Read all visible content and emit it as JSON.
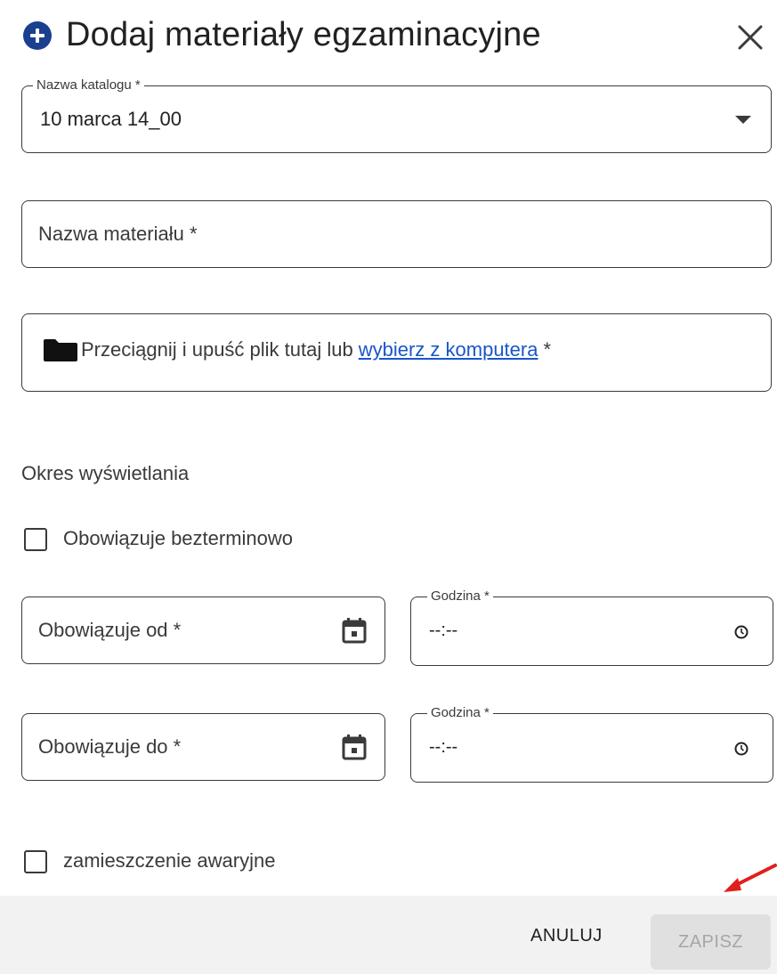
{
  "dialog": {
    "title": "Dodaj materiały egzaminacyjne"
  },
  "catalog_field": {
    "label": "Nazwa katalogu *",
    "value": "10 marca 14_00"
  },
  "material_name_field": {
    "placeholder": "Nazwa materiału *"
  },
  "upload_field": {
    "text": "Przeciągnij i upuść plik tutaj lub",
    "link": "wybierz z komputera",
    "required_mark": "*"
  },
  "display_period": {
    "label": "Okres wyświetlania",
    "indefinite_checkbox": "Obowiązuje bezterminowo"
  },
  "valid_from": {
    "placeholder": "Obowiązuje od *",
    "time_label": "Godzina *",
    "time_value": "--:--"
  },
  "valid_to": {
    "placeholder": "Obowiązuje do *",
    "time_label": "Godzina *",
    "time_value": "--:--"
  },
  "emergency_checkbox": "zamieszczenie awaryjne",
  "footer": {
    "cancel_label": "ANULUJ",
    "save_label": "ZAPISZ"
  },
  "colors": {
    "accent": "#1a3f8f",
    "link": "#1a56c9",
    "annotation_arrow": "#e0201b"
  },
  "icons": [
    "plus-circle-icon",
    "close-icon",
    "chevron-down-icon",
    "folder-icon",
    "calendar-icon",
    "clock-icon",
    "arrow-icon"
  ]
}
